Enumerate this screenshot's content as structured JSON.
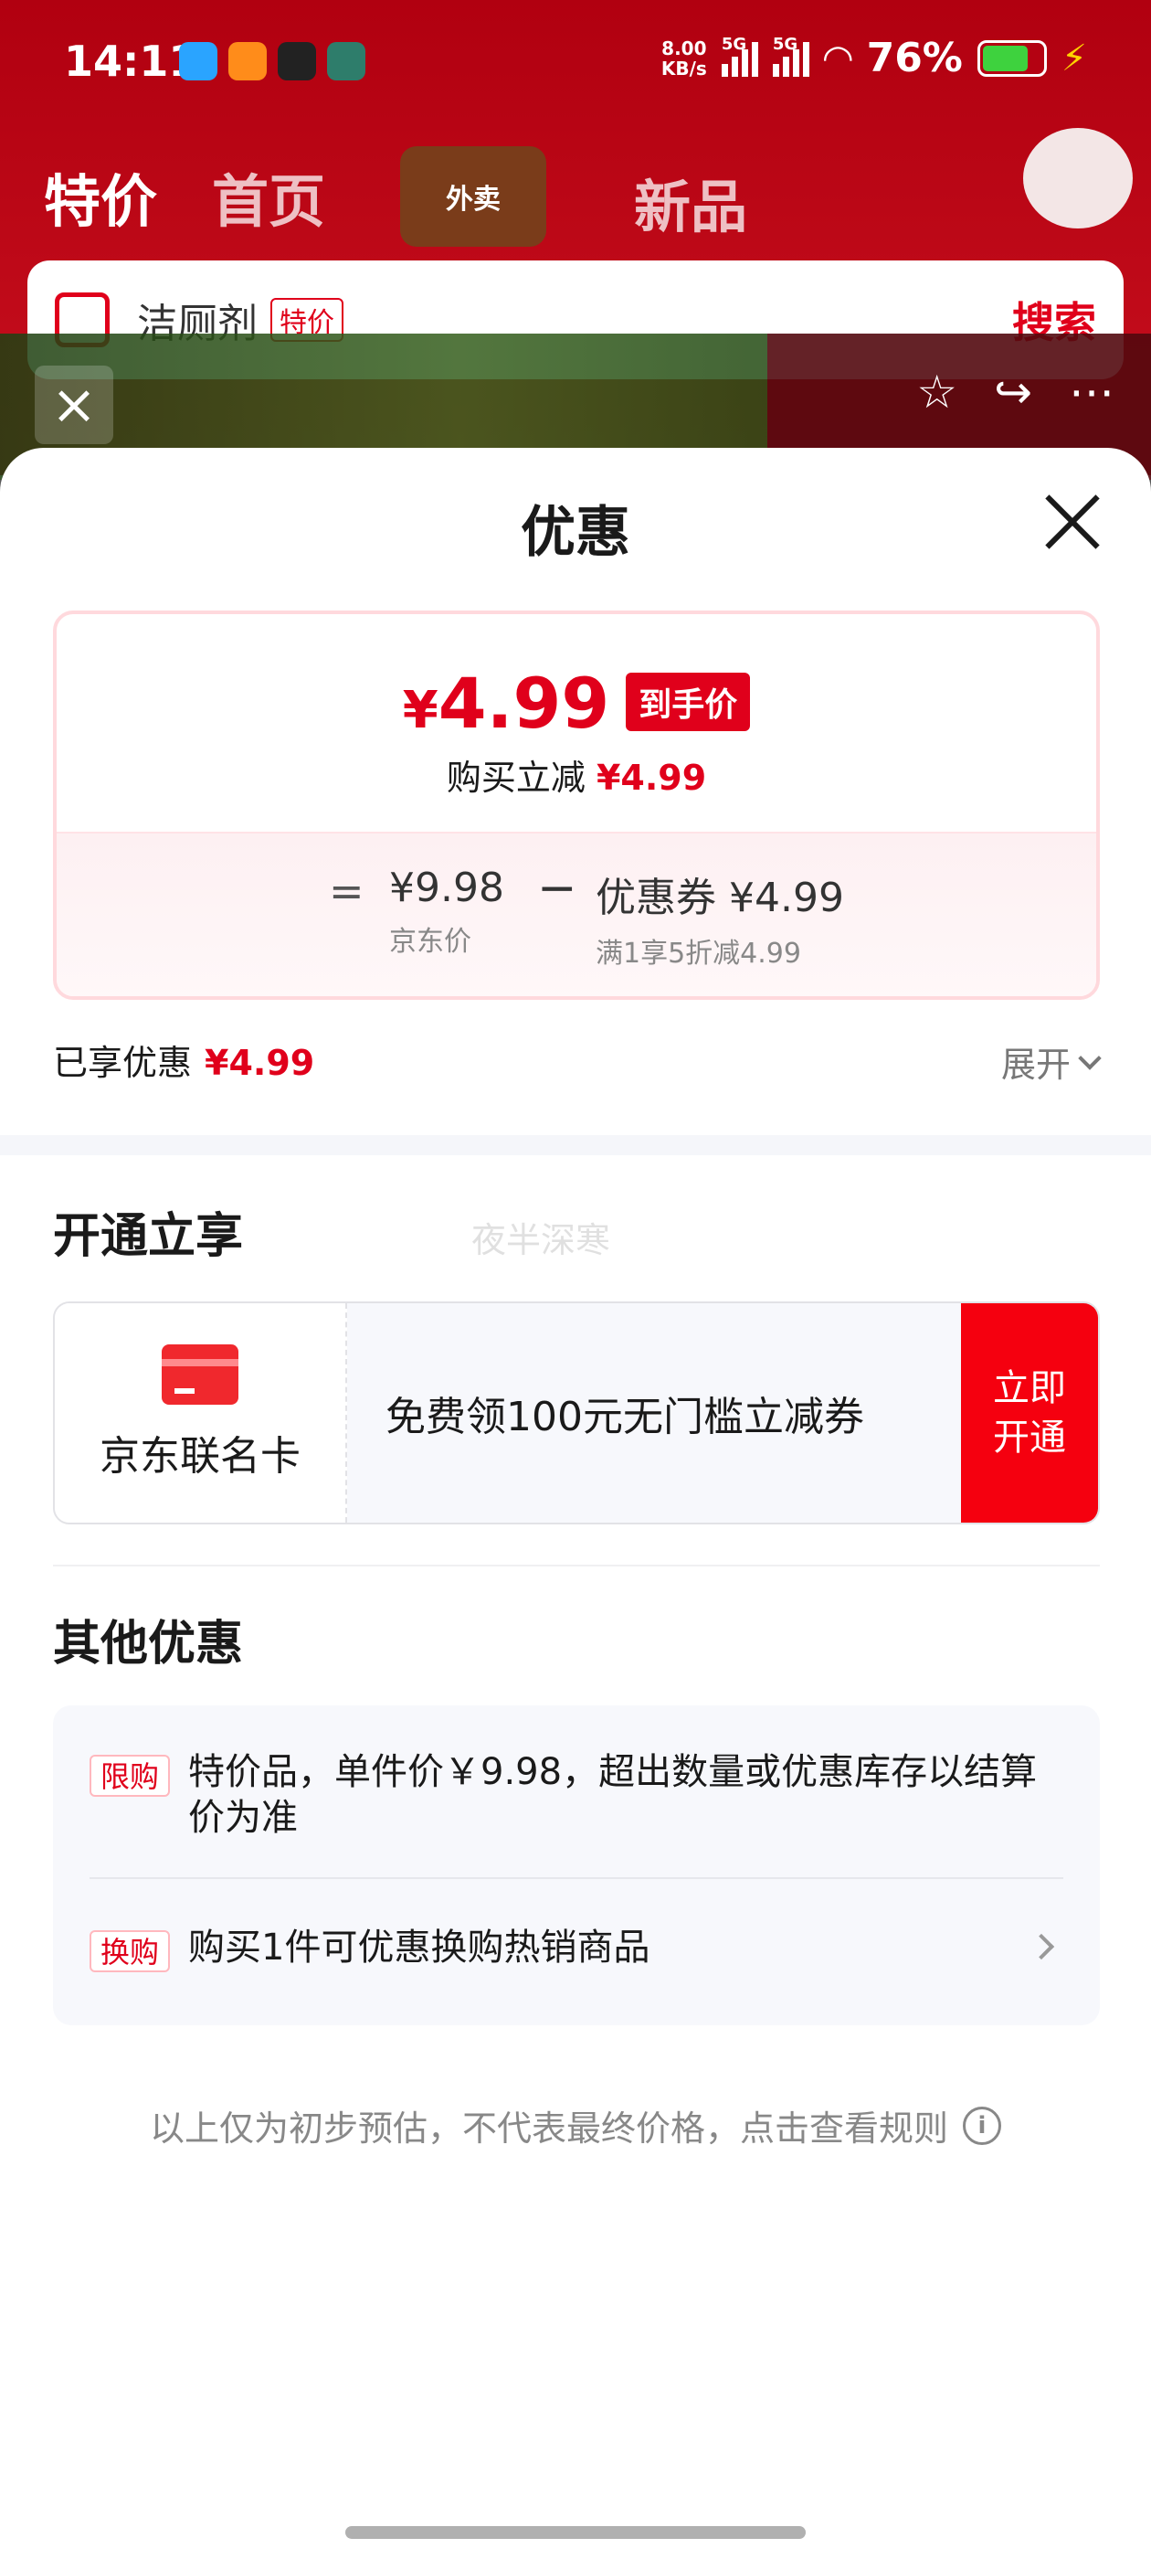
{
  "status": {
    "time": "14:11",
    "net_speed_value": "8.00",
    "net_speed_unit": "KB/s",
    "sim1": "5G",
    "sim2": "5G",
    "battery": "76%",
    "battery_level": 0.76,
    "battery_color": "#3ed23e"
  },
  "background": {
    "tabs": [
      "特价",
      "首页"
    ],
    "waimai_label": "外卖",
    "new_tab": "新品",
    "search_text": "洁厕剂",
    "search_tag": "特价",
    "search_button": "搜索"
  },
  "sheet": {
    "title": "优惠",
    "price": {
      "yen": "¥",
      "amount": "4.99",
      "badge": "到手价",
      "sub_label": "购买立减",
      "sub_value": "¥4.99"
    },
    "breakdown": {
      "equals": "=",
      "jd_price": "¥9.98",
      "jd_label": "京东价",
      "minus": "−",
      "coupon": "优惠券 ¥4.99",
      "coupon_rule": "满1享5折减4.99"
    },
    "enjoyed_label": "已享优惠",
    "enjoyed_value": "¥4.99",
    "expand_label": "展开",
    "open_title": "开通立享",
    "watermark": "夜半深寒",
    "card": {
      "name": "京东联名卡",
      "desc": "免费领100元无门槛立减券",
      "button": "立即开通"
    },
    "other_title": "其他优惠",
    "offers": [
      {
        "tag": "限购",
        "text": "特价品，单件价￥9.98，超出数量或优惠库存以结算价为准"
      },
      {
        "tag": "换购",
        "text": "购买1件可优惠换购热销商品"
      }
    ],
    "disclaimer": "以上仅为初步预估，不代表最终价格，点击查看规则",
    "accent_color": "#e0001b"
  }
}
